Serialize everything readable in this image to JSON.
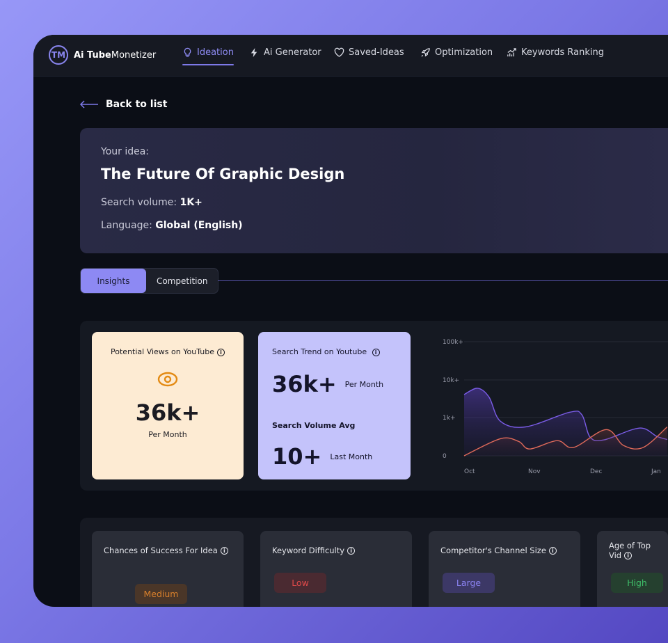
{
  "brand": {
    "bold": "Ai Tube",
    "rest": "Monetizer",
    "mark": "TM"
  },
  "nav": [
    {
      "label": "Ideation",
      "icon": "lightbulb-icon",
      "active": true
    },
    {
      "label": "Ai Generator",
      "icon": "lightning-icon"
    },
    {
      "label": "Saved-Ideas",
      "icon": "heart-icon"
    },
    {
      "label": "Optimization",
      "icon": "rocket-icon"
    },
    {
      "label": "Keywords Ranking",
      "icon": "chart-trend-icon"
    }
  ],
  "back_label": "Back to list",
  "idea": {
    "label": "Your idea:",
    "title": "The Future Of Graphic Design",
    "volume_label": "Search volume:",
    "volume_value": "1K+",
    "language_label": "Language:",
    "language_value": "Global (English)"
  },
  "tabs": [
    {
      "label": "Insights",
      "active": true
    },
    {
      "label": "Competition"
    }
  ],
  "potential": {
    "title": "Potential Views on YouTube",
    "value": "36k+",
    "unit": "Per Month",
    "icon": "eye-icon"
  },
  "trend": {
    "title": "Search Trend on Youtube",
    "value": "36k+",
    "unit": "Per Month",
    "avg_title": "Search Volume Avg",
    "avg_value": "10+",
    "avg_unit": "Last Month"
  },
  "chart_data": {
    "type": "area",
    "y_ticks": [
      "0",
      "1k+",
      "10k+",
      "100k+"
    ],
    "x_ticks": [
      "Oct",
      "Nov",
      "Dec",
      "Jan"
    ],
    "grid": true,
    "series": [
      {
        "color": "#7a5ce6",
        "x": [
          "10-01",
          "10-07",
          "10-12",
          "10-17",
          "10-28",
          "11-18",
          "11-24",
          "11-28",
          "12-05",
          "12-23",
          "01-01",
          "01-06"
        ],
        "values": [
          4100,
          6000,
          3500,
          910,
          760,
          1400,
          1200,
          490,
          420,
          730,
          510,
          430
        ]
      },
      {
        "color": "#e06a5a",
        "x": [
          "10-01",
          "10-17",
          "10-25",
          "10-30",
          "11-12",
          "11-20",
          "12-06",
          "12-15",
          "12-25",
          "01-06"
        ],
        "values": [
          0,
          450,
          380,
          180,
          400,
          220,
          690,
          270,
          220,
          760
        ]
      }
    ]
  },
  "metrics": [
    {
      "title": "Chances of Success For Idea",
      "value": "Medium",
      "fg": "#d9802c",
      "bg": "#4a3628"
    },
    {
      "title": "Keyword Difficulty",
      "value": "Low",
      "fg": "#e04a4a",
      "bg": "#4a2a31"
    },
    {
      "title": "Competitor's Channel Size",
      "value": "Large",
      "fg": "#8a82f0",
      "bg": "#3c3866"
    },
    {
      "title": "Age of Top Vid",
      "value": "High",
      "fg": "#3fbf6a",
      "bg": "#25402f"
    }
  ]
}
